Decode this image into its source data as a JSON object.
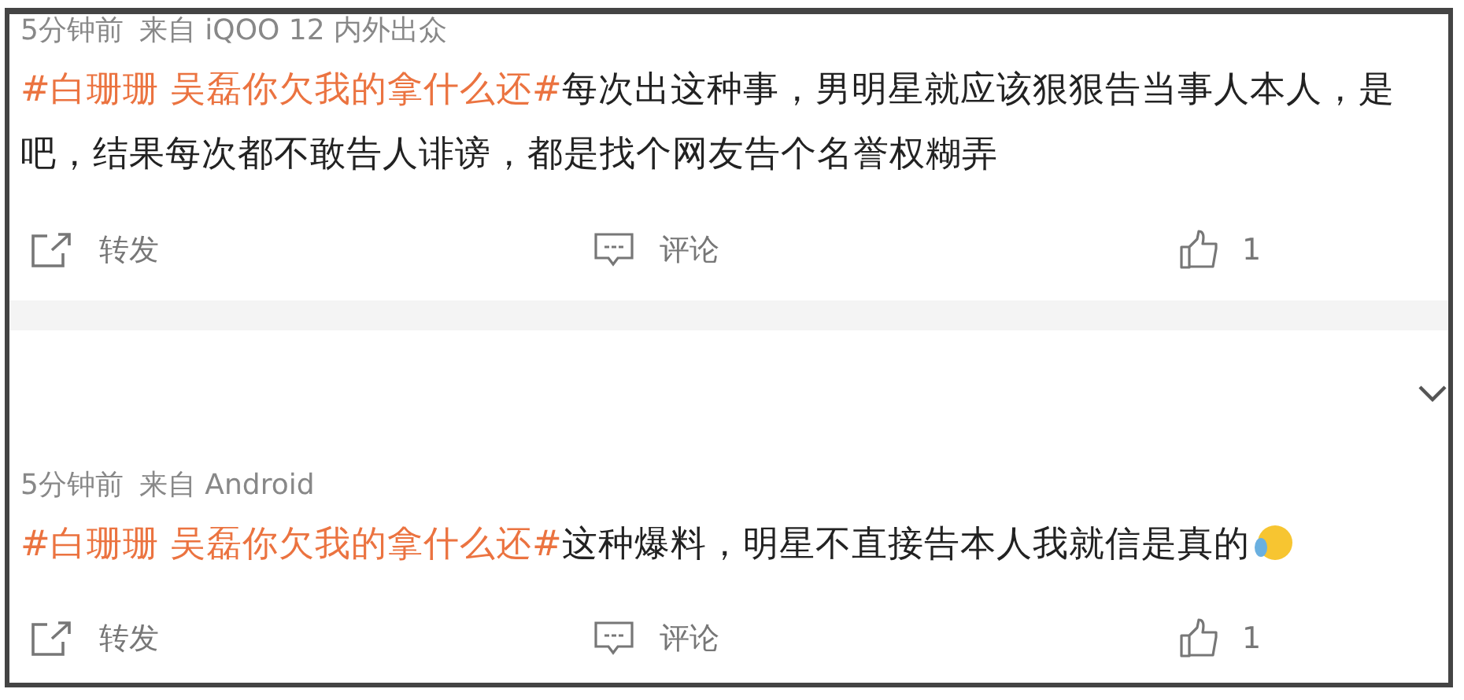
{
  "posts": [
    {
      "time": "5分钟前",
      "source": "来自 iQOO 12 内外出众",
      "topic": "#白珊珊 吴磊你欠我的拿什么还#",
      "text": "每次出这种事，男明星就应该狠狠告当事人本人，是吧，结果每次都不敢告人诽谤，都是找个网友告个名誉权糊弄",
      "has_emoji": false,
      "actions": [
        {
          "kind": "repost",
          "label": "转发"
        },
        {
          "kind": "comment",
          "label": "评论"
        },
        {
          "kind": "like",
          "label": "1"
        }
      ]
    },
    {
      "time": "5分钟前",
      "source": "来自 Android",
      "topic": "#白珊珊 吴磊你欠我的拿什么还#",
      "text": "这种爆料，明星不直接告本人我就信是真的",
      "has_emoji": true,
      "actions": [
        {
          "kind": "repost",
          "label": "转发"
        },
        {
          "kind": "comment",
          "label": "评论"
        },
        {
          "kind": "like",
          "label": "1"
        }
      ]
    }
  ]
}
